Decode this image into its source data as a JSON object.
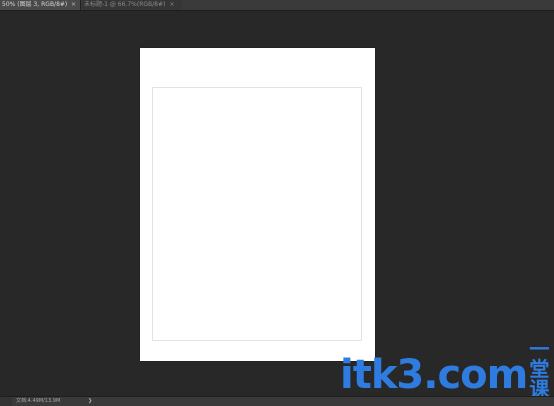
{
  "tabs": [
    {
      "label": "50% (图层 3, RGB/8#) *",
      "close": "×",
      "active": true
    },
    {
      "label": "未标题-1 @ 66.7%(RGB/8#)",
      "close": "×",
      "active": false
    }
  ],
  "statusbar": {
    "doc_info": "文档:4.49M/13.9M",
    "arrow": "❯"
  },
  "watermark": {
    "brand": "itk3",
    "suffix": ".com",
    "cn": "一堂课"
  },
  "colors": {
    "workspace": "#282828",
    "document": "#ffffff",
    "watermark": "#2f7ce0"
  }
}
